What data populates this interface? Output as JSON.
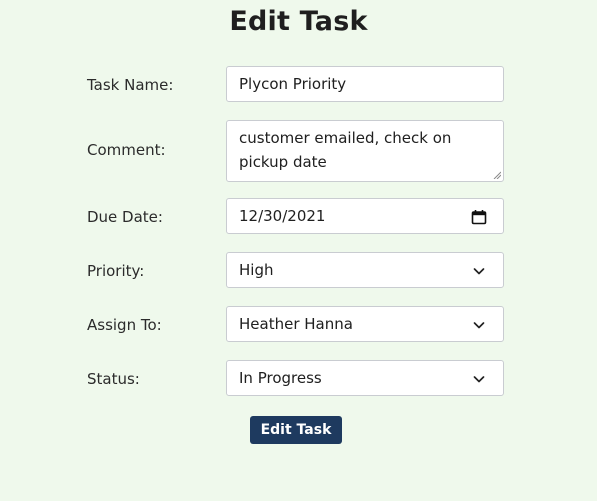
{
  "page": {
    "title": "Edit Task"
  },
  "form": {
    "task_name": {
      "label": "Task Name:",
      "value": "Plycon Priority"
    },
    "comment": {
      "label": "Comment:",
      "value": "customer emailed, check on pickup date"
    },
    "due_date": {
      "label": "Due Date:",
      "value": "12/30/2021",
      "icon": "calendar-icon"
    },
    "priority": {
      "label": "Priority:",
      "value": "High",
      "icon": "chevron-down-icon"
    },
    "assign_to": {
      "label": "Assign To:",
      "value": "Heather Hanna",
      "icon": "chevron-down-icon"
    },
    "status": {
      "label": "Status:",
      "value": "In Progress",
      "icon": "chevron-down-icon"
    },
    "submit_label": "Edit Task"
  },
  "colors": {
    "background": "#eff9ec",
    "button": "#1e3a5f",
    "field_border": "#c9ccd1"
  }
}
